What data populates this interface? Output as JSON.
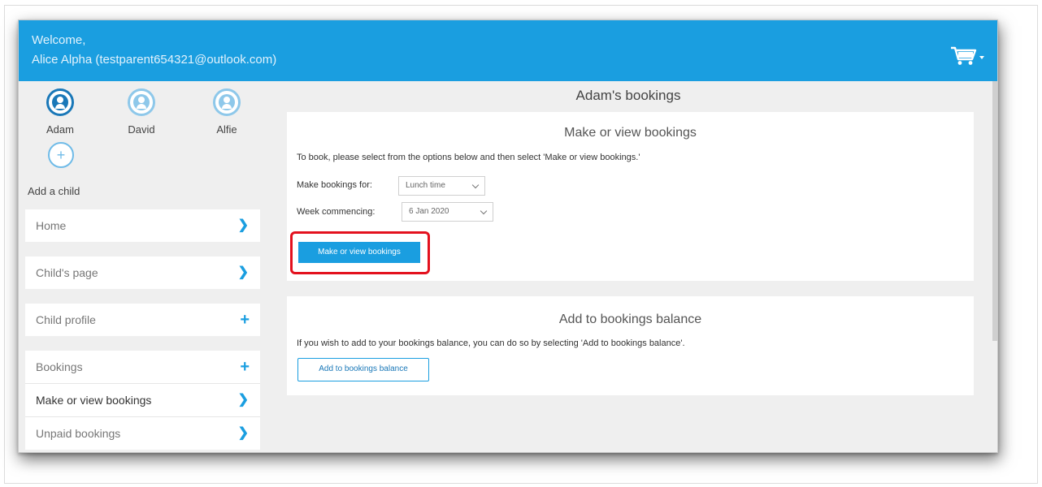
{
  "header": {
    "welcome": "Welcome,",
    "user": "Alice Alpha (testparent654321@outlook.com)",
    "cart_icon": "shopping-cart-icon",
    "brand_color": "#1a9ee0"
  },
  "children": [
    {
      "name": "Adam",
      "active": true
    },
    {
      "name": "David",
      "active": false
    },
    {
      "name": "Alfie",
      "active": false
    }
  ],
  "add_child": {
    "label": "Add a child",
    "icon": "plus-circle-icon"
  },
  "nav": {
    "home": "Home",
    "childs_page": "Child's page",
    "child_profile": "Child profile",
    "bookings": "Bookings",
    "make_or_view": "Make or view bookings",
    "unpaid": "Unpaid bookings"
  },
  "main": {
    "title": "Adam's bookings",
    "make_card": {
      "title": "Make or view bookings",
      "instructions": "To book, please select from the options below and then select 'Make or view bookings.'",
      "bookings_for_label": "Make bookings for:",
      "bookings_for_value": "Lunch time",
      "week_label": "Week commencing:",
      "week_value": "6 Jan 2020",
      "button": "Make or view bookings"
    },
    "balance_card": {
      "title": "Add to bookings balance",
      "instructions": "If you wish to add to your bookings balance, you can do so by selecting 'Add to bookings balance'.",
      "button": "Add to bookings balance"
    }
  }
}
